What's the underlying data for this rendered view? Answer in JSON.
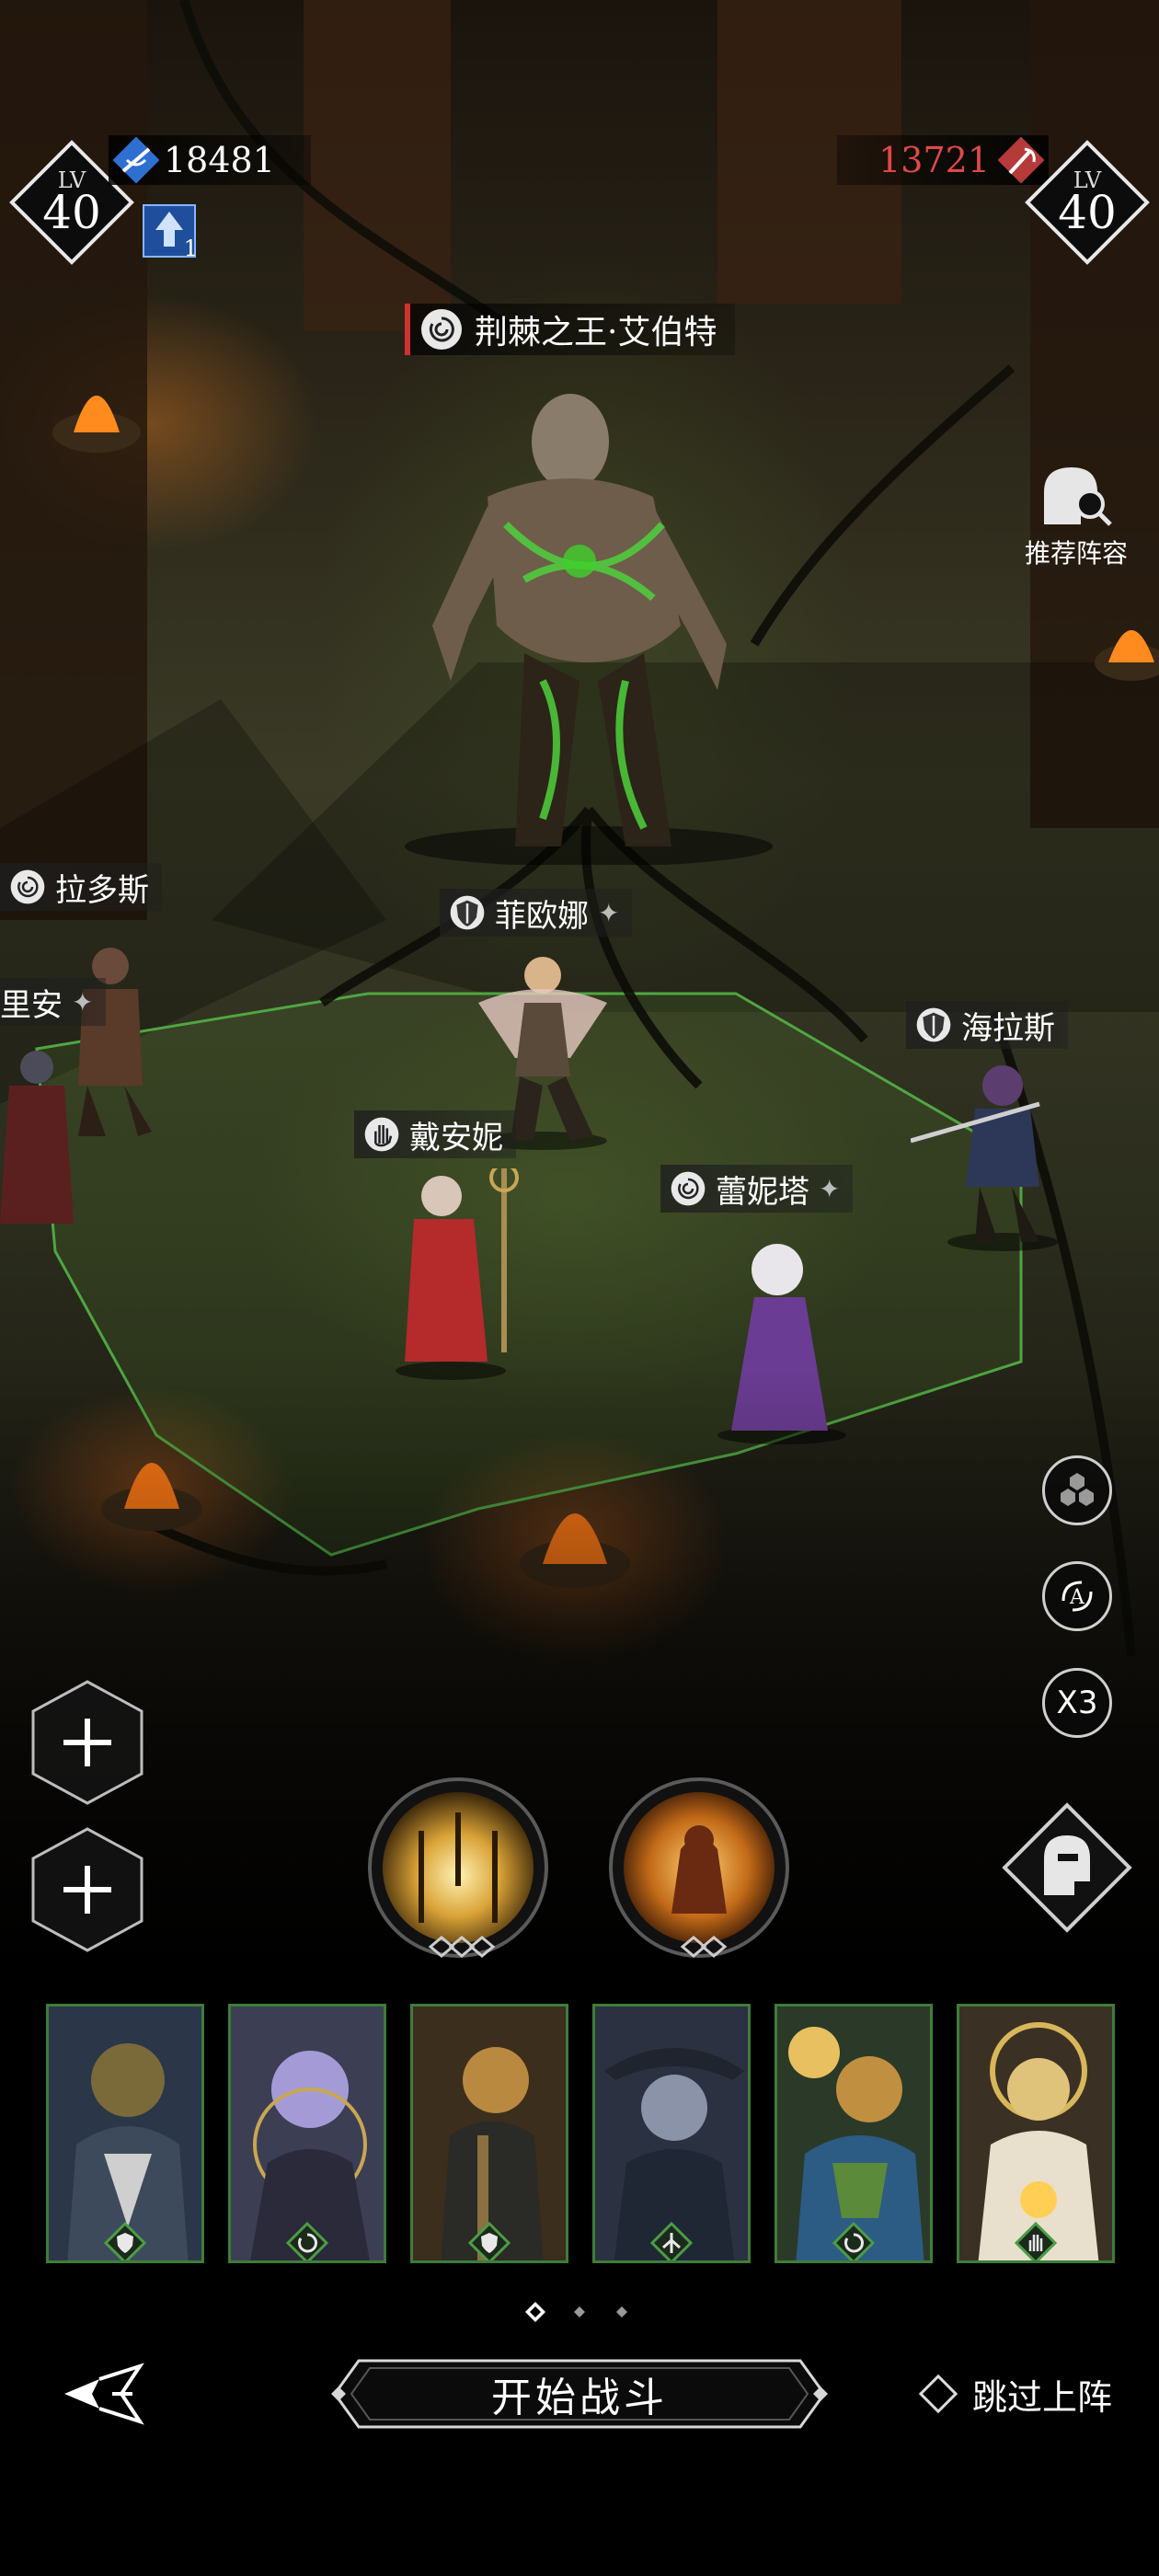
{
  "player": {
    "level_label": "LV",
    "level": "40",
    "power": "18481",
    "boost_count": "1",
    "accent": "#2f6fd1"
  },
  "enemy": {
    "level_label": "LV",
    "level": "40",
    "power": "13721",
    "accent": "#e04848"
  },
  "boss": {
    "name": "荆棘之王·艾伯特",
    "class_icon": "spiral-icon"
  },
  "units": [
    {
      "name": "拉多斯",
      "class_icon": "spiral-icon"
    },
    {
      "name": "里安",
      "class_icon": ""
    },
    {
      "name": "菲欧娜",
      "class_icon": "shield-icon"
    },
    {
      "name": "海拉斯",
      "class_icon": "shield-icon"
    },
    {
      "name": "戴安妮",
      "class_icon": "hand-icon"
    },
    {
      "name": "蕾妮塔",
      "class_icon": "spiral-icon"
    }
  ],
  "recommend_label": "推荐阵容",
  "speed_label": "X3",
  "heroes": [
    {
      "class_icon": "shield-icon",
      "palette": [
        "#2b3648",
        "#7a6a3a"
      ]
    },
    {
      "class_icon": "spiral-icon",
      "palette": [
        "#3c3e54",
        "#a49bd6"
      ]
    },
    {
      "class_icon": "shield-icon",
      "palette": [
        "#3b2e1c",
        "#b8893f"
      ]
    },
    {
      "class_icon": "arrows-icon",
      "palette": [
        "#2b3140",
        "#8b93a8"
      ]
    },
    {
      "class_icon": "spiral-icon",
      "palette": [
        "#2b3a28",
        "#c09040"
      ]
    },
    {
      "class_icon": "hand-icon",
      "palette": [
        "#3a3124",
        "#e0c37a"
      ]
    }
  ],
  "page_indicator": {
    "pages": 3,
    "current": 1
  },
  "start_button_label": "开始战斗",
  "skip_label": "跳过上阵"
}
